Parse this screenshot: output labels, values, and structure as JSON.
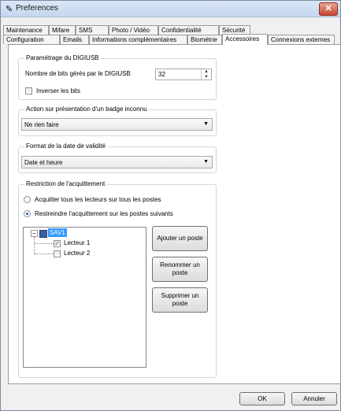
{
  "window": {
    "title": "Preferences",
    "close_label": "✕"
  },
  "tabs_row1": [
    "Maintenance",
    "Mifare",
    "SMS",
    "Photo / Vidéo",
    "Confidentialité",
    "Sécurité"
  ],
  "tabs_row2": [
    "Configuration",
    "Emails",
    "Informations complémentaires",
    "Biométrie",
    "Accessoires",
    "Connexions externes"
  ],
  "digiusb": {
    "legend": "Paramétrage du DIGIUSB",
    "bits_label": "Nombre de bits gérés par le DIGIUSB",
    "bits_value": "32",
    "invert_label": "Inverser les bits"
  },
  "badge": {
    "legend": "Action sur présentation d'un badge inconnu",
    "value": "Ne rien faire"
  },
  "date_format": {
    "legend": "Format de la date de validité",
    "value": "Date et heure"
  },
  "ack": {
    "legend": "Restriction de l'acquittement",
    "option_all": "Acquitter tous les lecteurs sur tous les postes",
    "option_some": "Restreindre l'acquittement sur les postes suivants",
    "tree_root": "SAV1",
    "reader1": "Lecteur 1",
    "reader2": "Lecteur 2",
    "add_button": "Ajouter un poste",
    "rename_button": "Renommer un poste",
    "delete_button": "Supprimer un poste"
  },
  "footer": {
    "ok": "OK",
    "cancel": "Annuler"
  }
}
